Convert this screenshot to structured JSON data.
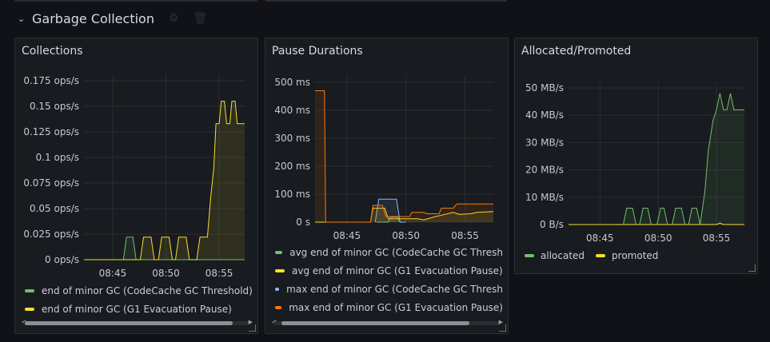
{
  "row": {
    "title": "Garbage Collection"
  },
  "panels": [
    {
      "title": "Collections",
      "legend": [
        "end of minor GC (CodeCache GC Threshold)",
        "end of minor GC (G1 Evacuation Pause)"
      ]
    },
    {
      "title": "Pause Durations",
      "legend": [
        "avg end of minor GC (CodeCache GC Thresh",
        "avg end of minor GC (G1 Evacuation Pause)",
        "max end of minor GC (CodeCache GC Thresh",
        "max end of minor GC (G1 Evacuation Pause)"
      ]
    },
    {
      "title": "Allocated/Promoted",
      "legend": [
        "allocated",
        "promoted"
      ]
    }
  ],
  "colors": {
    "green": "#73bf69",
    "yellow": "#fade2a",
    "blue": "#8ab8ff",
    "orange": "#ff780a"
  },
  "chart_data": [
    {
      "type": "line",
      "title": "Collections",
      "y_ticks": [
        "0 ops/s",
        "0.025 ops/s",
        "0.05 ops/s",
        "0.075 ops/s",
        "0.1 ops/s",
        "0.125 ops/s",
        "0.15 ops/s",
        "0.175 ops/s"
      ],
      "x_ticks": [
        "08:45",
        "08:50",
        "08:55"
      ],
      "ylim": [
        0,
        0.175
      ],
      "xlim": [
        42.3,
        57.4
      ],
      "series": [
        {
          "name": "end of minor GC (CodeCache GC Threshold)",
          "color": "#73bf69",
          "x": [
            42.3,
            46.0,
            46.3,
            46.9,
            47.2,
            57.4
          ],
          "y": [
            0,
            0,
            0.022,
            0.022,
            0,
            0
          ]
        },
        {
          "name": "end of minor GC (G1 Evacuation Pause)",
          "color": "#fade2a",
          "x": [
            42.3,
            47.6,
            47.9,
            48.6,
            48.9,
            49.3,
            49.6,
            50.3,
            50.6,
            50.9,
            51.2,
            51.9,
            52.2,
            52.9,
            53.2,
            53.9,
            54.2,
            54.5,
            54.7,
            55.0,
            55.2,
            55.5,
            55.7,
            56.0,
            56.2,
            56.5,
            56.7,
            57.0,
            57.4
          ],
          "y": [
            0,
            0,
            0.022,
            0.022,
            0,
            0,
            0.022,
            0.022,
            0,
            0,
            0.022,
            0.022,
            0,
            0,
            0.022,
            0.022,
            0.06,
            0.09,
            0.133,
            0.133,
            0.155,
            0.155,
            0.133,
            0.133,
            0.155,
            0.155,
            0.133,
            0.133,
            0.133
          ]
        }
      ]
    },
    {
      "type": "line",
      "title": "Pause Durations",
      "y_ticks": [
        "0 s",
        "100 ms",
        "200 ms",
        "300 ms",
        "400 ms",
        "500 ms"
      ],
      "x_ticks": [
        "08:45",
        "08:50",
        "08:55"
      ],
      "ylim": [
        0,
        500
      ],
      "xlim": [
        42.3,
        57.4
      ],
      "series": [
        {
          "name": "avg end of minor GC (CodeCache GC Thresh",
          "color": "#73bf69",
          "x": [
            47.5,
            48.5,
            48.7,
            49.3,
            49.5
          ],
          "y": [
            0,
            0,
            18,
            18,
            0
          ]
        },
        {
          "name": "avg end of minor GC (G1 Evacuation Pause)",
          "color": "#fade2a",
          "x": [
            42.3,
            43.0,
            43.1,
            47.0,
            47.2,
            48.2,
            48.5,
            51.0,
            51.5,
            52.5,
            53.0,
            54.0,
            54.5,
            55.5,
            56.0,
            57.4
          ],
          "y": [
            0,
            0,
            0,
            0,
            50,
            50,
            12,
            12,
            8,
            20,
            25,
            35,
            28,
            30,
            35,
            38
          ]
        },
        {
          "name": "max end of minor GC (CodeCache GC Thresh",
          "color": "#8ab8ff",
          "x": [
            47.4,
            47.7,
            49.2,
            49.5,
            50.0
          ],
          "y": [
            0,
            82,
            82,
            0,
            0
          ]
        },
        {
          "name": "max end of minor GC (G1 Evacuation Pause)",
          "color": "#ff780a",
          "x": [
            42.3,
            43.1,
            43.2,
            47.0,
            47.2,
            48.0,
            48.3,
            50.3,
            50.5,
            51.5,
            51.8,
            52.8,
            53.0,
            54.0,
            54.3,
            55.0,
            55.2,
            57.4
          ],
          "y": [
            470,
            470,
            0,
            0,
            60,
            60,
            20,
            20,
            35,
            35,
            30,
            30,
            50,
            50,
            65,
            65,
            65,
            65
          ]
        }
      ]
    },
    {
      "type": "line",
      "title": "Allocated/Promoted",
      "y_ticks": [
        "0 B/s",
        "10 MB/s",
        "20 MB/s",
        "30 MB/s",
        "40 MB/s",
        "50 MB/s"
      ],
      "x_ticks": [
        "08:45",
        "08:50",
        "08:55"
      ],
      "ylim": [
        0,
        50
      ],
      "xlim": [
        42.3,
        57.4
      ],
      "series": [
        {
          "name": "allocated",
          "color": "#73bf69",
          "x": [
            42.3,
            47.0,
            47.3,
            47.8,
            48.1,
            48.4,
            48.7,
            49.1,
            49.4,
            49.9,
            50.2,
            50.5,
            50.8,
            51.2,
            51.5,
            52.0,
            52.3,
            52.6,
            52.9,
            53.3,
            53.6,
            54.0,
            54.3,
            54.7,
            55.0,
            55.3,
            55.6,
            55.9,
            56.2,
            56.5,
            56.8,
            57.1,
            57.4
          ],
          "y": [
            0,
            0,
            6,
            6,
            0,
            0,
            6,
            6,
            0,
            0,
            6,
            6,
            0,
            0,
            6,
            6,
            0,
            0,
            6,
            6,
            0,
            12,
            27,
            38,
            42,
            48,
            42,
            42,
            48,
            42,
            42,
            42,
            42
          ]
        },
        {
          "name": "promoted",
          "color": "#fade2a",
          "x": [
            42.3,
            55.0,
            55.3,
            55.6,
            57.4
          ],
          "y": [
            0,
            0,
            0.5,
            0,
            0
          ]
        }
      ]
    }
  ]
}
